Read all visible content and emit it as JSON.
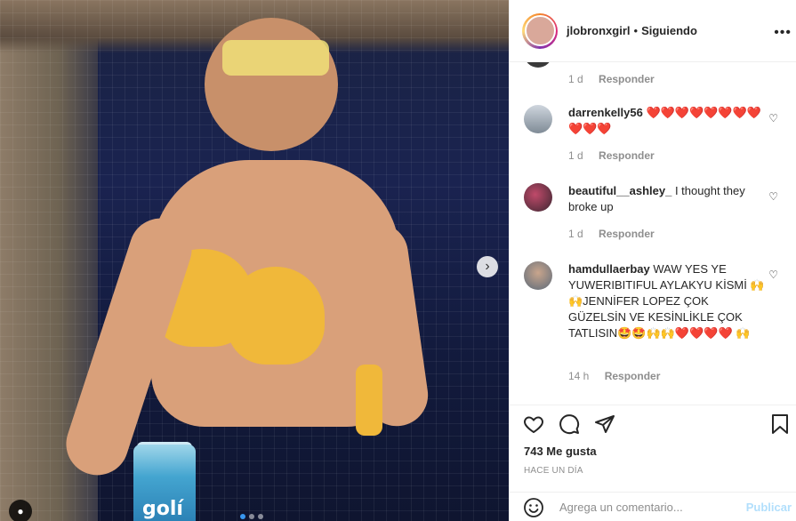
{
  "post": {
    "username": "jlobronxgirl",
    "separator": "•",
    "follow_status": "Siguiendo",
    "more_label": "•••",
    "image_brand": "golí",
    "next_icon": "chevron-right-icon"
  },
  "comments": [
    {
      "username": "",
      "text": "",
      "time": "1 d",
      "reply": "Responder"
    },
    {
      "username": "darrenkelly56",
      "text": "❤️❤️❤️❤️❤️❤️❤️❤️❤️❤️❤️",
      "time": "1 d",
      "reply": "Responder"
    },
    {
      "username": "beautiful__ashley_",
      "text": "I thought they broke up",
      "time": "1 d",
      "reply": "Responder"
    },
    {
      "username": "hamdullaerbay",
      "text": "WAW YES YE YUWERIBITIFUL AYLAKYU KİSMİ 🙌🙌JENNİFER LOPEZ ÇOK GÜZELSİN VE KESİNLİKLE ÇOK TATLISIN🤩🤩🙌🙌❤️❤️❤️❤️ 🙌",
      "time": "14 h",
      "reply": "Responder"
    }
  ],
  "actions": {
    "likes": "743 Me gusta",
    "date": "HACE UN DÍA"
  },
  "composer": {
    "placeholder": "Agrega un comentario...",
    "post_label": "Publicar"
  },
  "colors": {
    "accent": "#0095f6",
    "text": "#262626",
    "muted": "#8e8e8e",
    "post_disabled": "#b2dffc"
  }
}
